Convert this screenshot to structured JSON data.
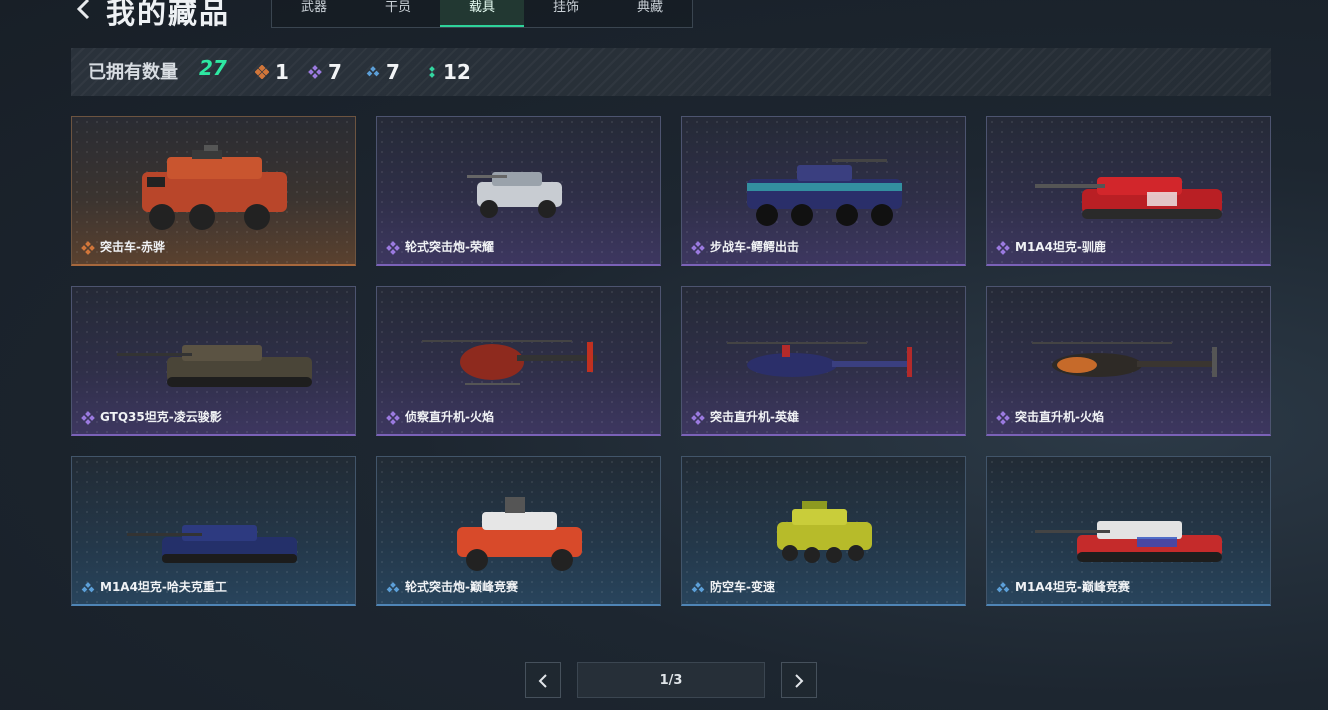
{
  "header": {
    "title": "我的藏品",
    "tabs": [
      {
        "label": "武器",
        "active": false
      },
      {
        "label": "干员",
        "active": false
      },
      {
        "label": "载具",
        "active": true
      },
      {
        "label": "挂饰",
        "active": false
      },
      {
        "label": "典藏",
        "active": false
      }
    ]
  },
  "stats": {
    "owned_label": "已拥有数量",
    "owned_count": "27",
    "rarities": [
      {
        "icon": "diamond-orange-icon",
        "color": "#d2763a",
        "count": "1"
      },
      {
        "icon": "diamond-purple-icon",
        "color": "#9b7ae0",
        "count": "7"
      },
      {
        "icon": "diamond-blue-icon",
        "color": "#5c9fd8",
        "count": "7"
      },
      {
        "icon": "dots-green-icon",
        "color": "#33d6a0",
        "count": "12"
      }
    ]
  },
  "items": [
    {
      "name": "突击车-赤骅",
      "rarity": "orange"
    },
    {
      "name": "轮式突击炮-荣耀",
      "rarity": "purple"
    },
    {
      "name": "步战车-鳄鳄出击",
      "rarity": "purple"
    },
    {
      "name": "M1A4坦克-驯鹿",
      "rarity": "purple"
    },
    {
      "name": "GTQ35坦克-凌云骏影",
      "rarity": "purple"
    },
    {
      "name": "侦察直升机-火焰",
      "rarity": "purple"
    },
    {
      "name": "突击直升机-英雄",
      "rarity": "purple"
    },
    {
      "name": "突击直升机-火焰",
      "rarity": "purple"
    },
    {
      "name": "M1A4坦克-哈夫克重工",
      "rarity": "blue"
    },
    {
      "name": "轮式突击炮-巅峰竞赛",
      "rarity": "blue"
    },
    {
      "name": "防空车-变速",
      "rarity": "blue"
    },
    {
      "name": "M1A4坦克-巅峰竞赛",
      "rarity": "blue"
    }
  ],
  "pagination": {
    "label": "1/3"
  },
  "colors": {
    "accent": "#2ee8a2",
    "orange": "#d2763a",
    "purple": "#9b7ae0",
    "blue": "#5c9fd8"
  }
}
